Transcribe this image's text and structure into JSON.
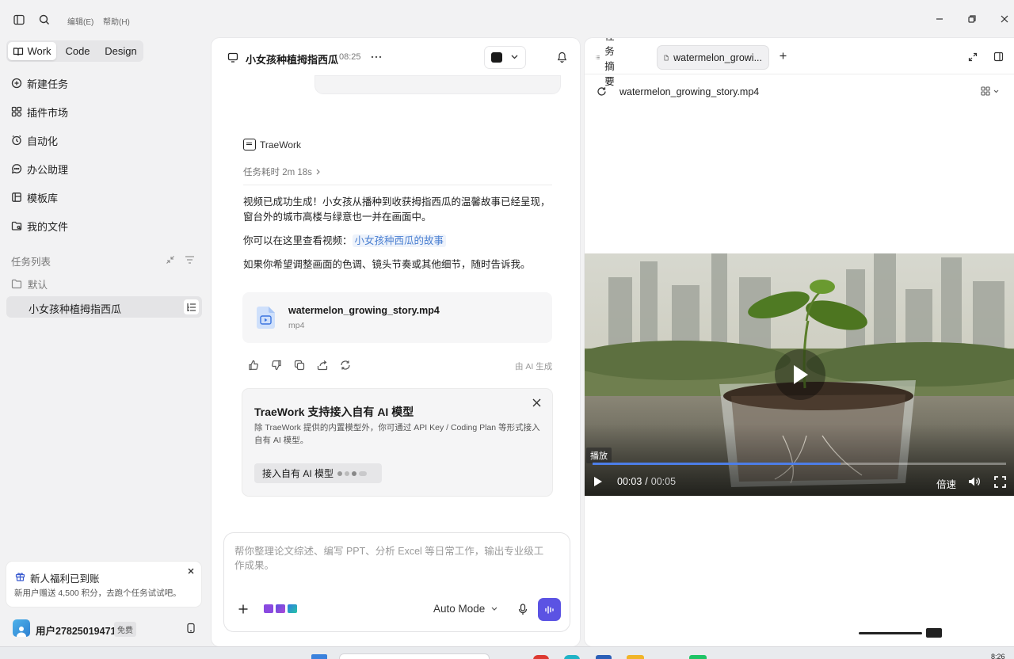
{
  "menu": {
    "edit": "编辑(E)",
    "help": "帮助(H)"
  },
  "modes": {
    "work": "Work",
    "code": "Code",
    "design": "Design"
  },
  "nav": [
    {
      "label": "新建任务",
      "icon": "new-task-icon"
    },
    {
      "label": "插件市场",
      "icon": "plugin-market-icon"
    },
    {
      "label": "自动化",
      "icon": "alarm-icon"
    },
    {
      "label": "办公助理",
      "icon": "chat-bubble-icon"
    },
    {
      "label": "模板库",
      "icon": "template-icon"
    },
    {
      "label": "我的文件",
      "icon": "files-icon"
    }
  ],
  "task_list": {
    "title": "任务列表",
    "folder": "默认",
    "items": [
      "小女孩种植拇指西瓜"
    ]
  },
  "notice": {
    "title": "新人福利已到账",
    "body": "新用户赠送 4,500 积分，去跑个任务试试吧。"
  },
  "user": {
    "name": "用户27825019471",
    "plan": "免费"
  },
  "chat": {
    "title": "小女孩种植拇指西瓜",
    "time": "08:25",
    "agent": "TraeWork",
    "duration": "任务耗时 2m 18s",
    "para1": "视频已成功生成！小女孩从播种到收获拇指西瓜的温馨故事已经呈现，窗台外的城市高楼与绿意也一并在画面中。",
    "para2_prefix": "你可以在这里查看视频：",
    "para2_link": "小女孩种西瓜的故事",
    "para3": "如果你希望调整画面的色调、镜头节奏或其他细节，随时告诉我。",
    "file_name": "watermelon_growing_story.mp4",
    "file_ext": "mp4",
    "ai_generated": "由 AI 生成",
    "promo_title": "TraeWork 支持接入自有 AI 模型",
    "promo_body": "除 TraeWork 提供的内置模型外，你可通过 API Key / Coding Plan 等形式接入自有 AI 模型。",
    "promo_button": "接入自有 AI 模型",
    "input_placeholder": "帮你整理论文综述、编写 PPT、分析 Excel 等日常工作，输出专业级工作成果。",
    "mode_select": "Auto Mode"
  },
  "preview": {
    "tab_summary": "任务摘要",
    "tab_file": "watermelon_growi...",
    "file_name": "watermelon_growing_story.mp4",
    "tooltip": "播放",
    "current_time": "00:03",
    "separator": "/",
    "total_time": "00:05",
    "speed": "倍速",
    "progress": 0.6
  },
  "taskbar": {
    "clock": "8:26"
  }
}
